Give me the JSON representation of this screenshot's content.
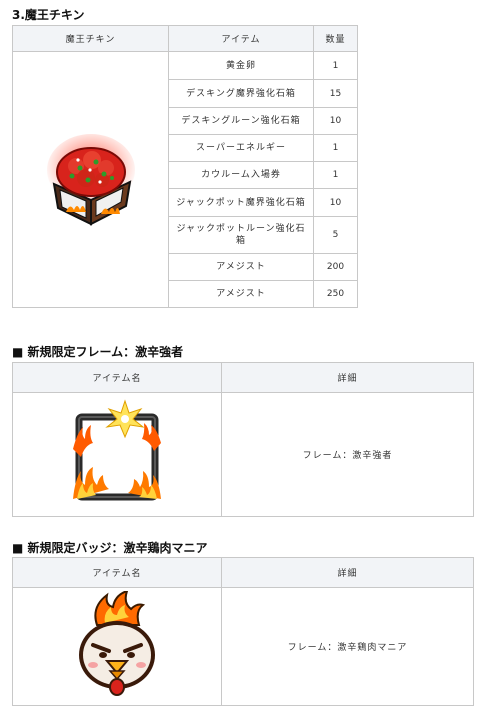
{
  "section1": {
    "title": "3.魔王チキン",
    "headers": [
      "魔王チキン",
      "アイテム",
      "数量"
    ],
    "image_label": "demon-chicken-box-image",
    "rows": [
      {
        "item": "黄金卵",
        "qty": "1"
      },
      {
        "item": "デスキング魔界強化石箱",
        "qty": "15"
      },
      {
        "item": "デスキングルーン強化石箱",
        "qty": "10"
      },
      {
        "item": "スーパーエネルギー",
        "qty": "1"
      },
      {
        "item": "カウルーム入場券",
        "qty": "1"
      },
      {
        "item": "ジャックポット魔界強化石箱",
        "qty": "10"
      },
      {
        "item": "ジャックポットルーン強化石箱",
        "qty": "5"
      },
      {
        "item": "アメジスト",
        "qty": "200"
      },
      {
        "item": "アメジスト",
        "qty": "250"
      }
    ]
  },
  "section2": {
    "title": "■ 新規限定フレーム：激辛強者",
    "headers": [
      "アイテム名",
      "詳細"
    ],
    "detail": "フレーム：激辛強者"
  },
  "section3": {
    "title": "■ 新規限定バッジ：激辛鶏肉マニア",
    "headers": [
      "アイテム名",
      "詳細"
    ],
    "detail": "フレーム：激辛鶏肉マニア"
  }
}
